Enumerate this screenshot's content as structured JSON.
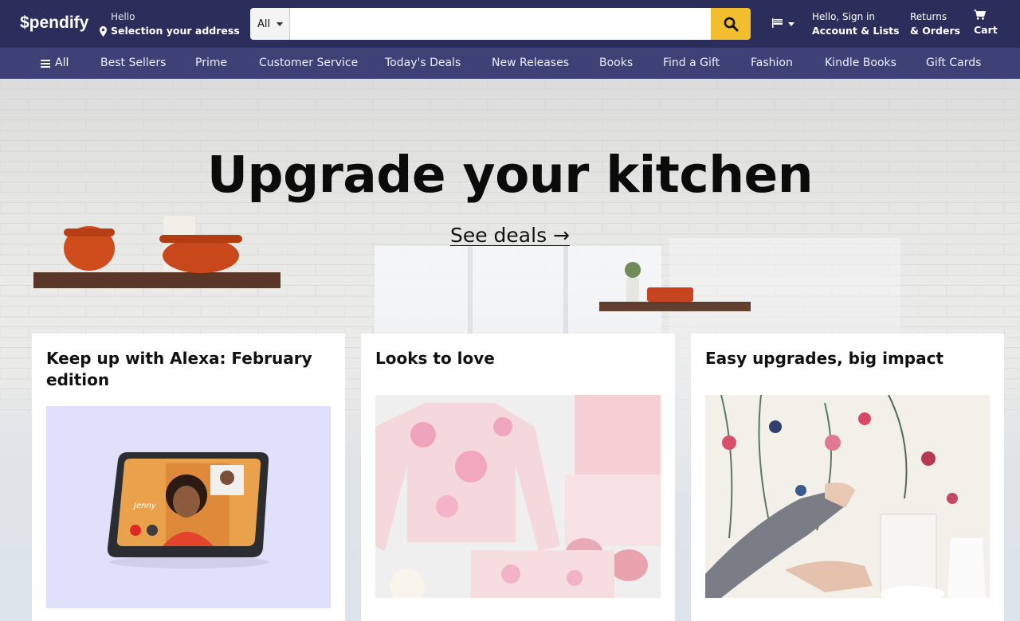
{
  "header": {
    "logo": "$pendify",
    "address_greeting": "Hello",
    "address_label": "Selection your address",
    "search": {
      "category": "All",
      "placeholder": "",
      "value": ""
    },
    "account_line1": "Hello, Sign in",
    "account_line2": "Account & Lists",
    "returns_line1": "Returns",
    "returns_line2": "& Orders",
    "cart_label": "Cart"
  },
  "nav": {
    "all_label": "All",
    "items": [
      "Best Sellers",
      "Prime",
      "Customer Service",
      "Today's Deals",
      "New Releases",
      "Books",
      "Find a Gift",
      "Fashion",
      "Kindle Books",
      "Gift Cards"
    ]
  },
  "hero": {
    "title": "Upgrade your kitchen",
    "link": "See deals →"
  },
  "cards": [
    {
      "title": "Keep up with Alexa: February edition",
      "image": "echo-show-video-call",
      "caller_name": "Jenny"
    },
    {
      "title": "Looks to love",
      "image": "tie-dye-loungewear"
    },
    {
      "title": "Easy upgrades, big impact",
      "image": "floral-peel-stick-wallpaper"
    }
  ],
  "colors": {
    "header_bg": "#2b2e5a",
    "nav_bg": "#3d4176",
    "search_button": "#f2be2e"
  },
  "icons": [
    "map-pin-icon",
    "search-icon",
    "flag-icon",
    "cart-icon",
    "hamburger-icon",
    "caret-down-icon"
  ]
}
